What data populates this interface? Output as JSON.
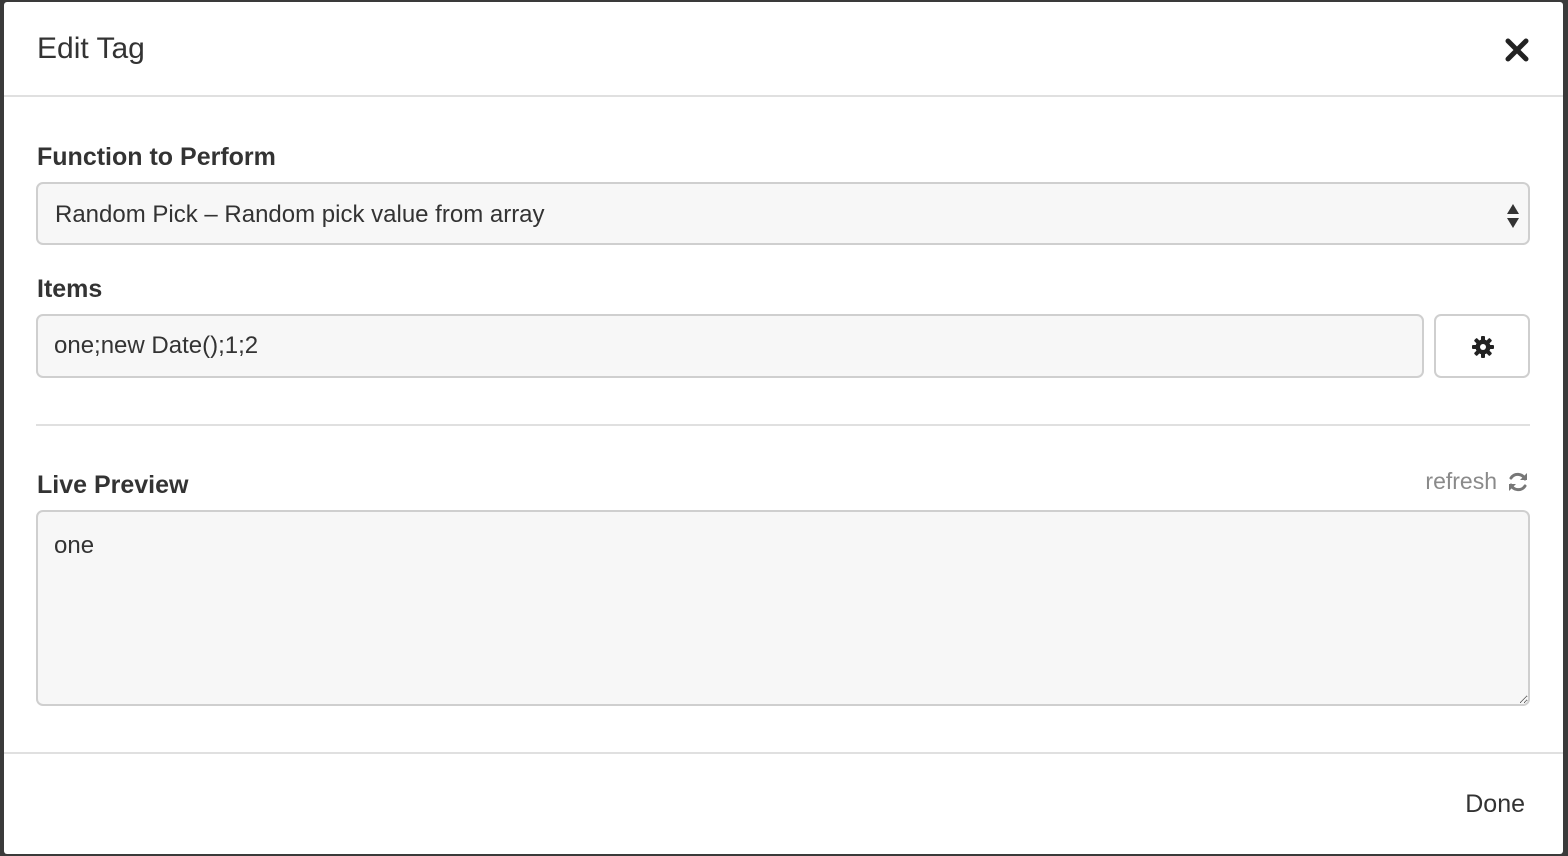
{
  "modal": {
    "title": "Edit Tag",
    "close_icon": "close-icon"
  },
  "function_field": {
    "label": "Function to Perform",
    "selected": "Random Pick – Random pick value from array",
    "icon": "select-arrows-icon"
  },
  "items_field": {
    "label": "Items",
    "value": "one;new Date();1;2",
    "settings_icon": "gear-icon"
  },
  "preview": {
    "label": "Live Preview",
    "refresh_label": "refresh",
    "refresh_icon": "refresh-icon",
    "value": "one"
  },
  "footer": {
    "done_label": "Done"
  },
  "colors": {
    "field_background": "#f7f7f7",
    "border": "#cfcfcf",
    "text": "#333333",
    "muted_text": "#8a8a8a"
  }
}
